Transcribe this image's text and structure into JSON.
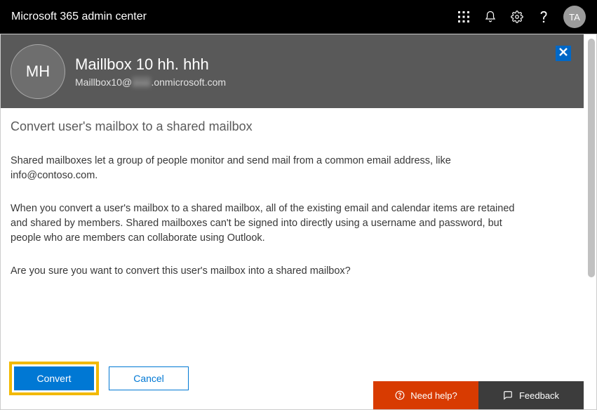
{
  "topbar": {
    "title": "Microsoft 365 admin center",
    "avatar_initials": "TA"
  },
  "user_header": {
    "avatar_initials": "MH",
    "display_name": "Maillbox 10 hh. hhh",
    "email_prefix": "Maillbox10@",
    "email_blurred": "-----",
    "email_suffix": ".onmicrosoft.com"
  },
  "section": {
    "title": "Convert user's mailbox to a shared mailbox",
    "para1": "Shared mailboxes let a group of people monitor and send mail from a common email address, like info@contoso.com.",
    "para2": "When you convert a user's mailbox to a shared mailbox, all of the existing email and calendar items are retained and shared by members. Shared mailboxes can't be signed into directly using a username and password, but people who are members can collaborate using Outlook.",
    "para3": "Are you sure you want to convert this user's mailbox into a shared mailbox?"
  },
  "buttons": {
    "convert": "Convert",
    "cancel": "Cancel"
  },
  "footer": {
    "need_help": "Need help?",
    "feedback": "Feedback"
  }
}
